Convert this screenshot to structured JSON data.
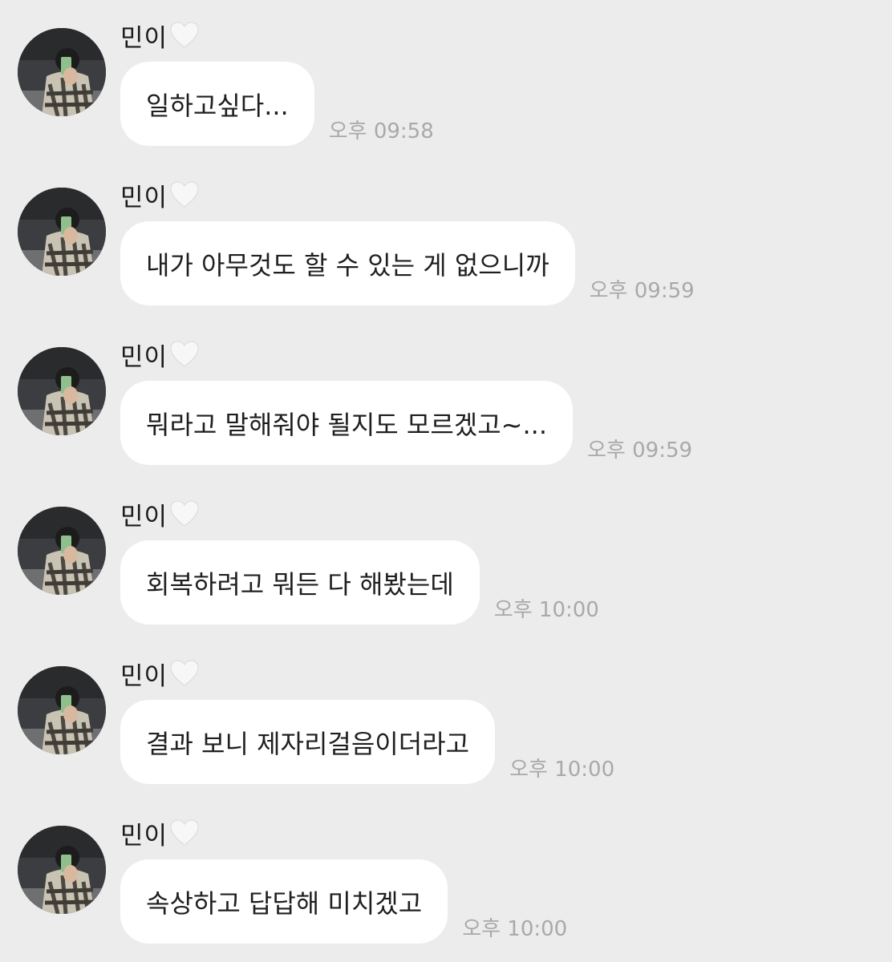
{
  "messages": [
    {
      "sender": "민이",
      "text": "일하고싶다...",
      "time": "오후 09:58"
    },
    {
      "sender": "민이",
      "text": "내가 아무것도 할 수 있는 게 없으니까",
      "time": "오후 09:59"
    },
    {
      "sender": "민이",
      "text": "뭐라고 말해줘야 될지도 모르겠고~...",
      "time": "오후 09:59"
    },
    {
      "sender": "민이",
      "text": "회복하려고 뭐든 다 해봤는데",
      "time": "오후 10:00"
    },
    {
      "sender": "민이",
      "text": "결과 보니 제자리걸음이더라고",
      "time": "오후 10:00"
    },
    {
      "sender": "민이",
      "text": "속상하고 답답해 미치겠고",
      "time": "오후 10:00"
    }
  ],
  "icons": {
    "heart": "white-heart-icon",
    "avatar": "profile-photo-mirror-selfie"
  },
  "colors": {
    "background": "#ececec",
    "bubble": "#ffffff",
    "time": "#a9a9a9",
    "text": "#1f1f1f"
  }
}
